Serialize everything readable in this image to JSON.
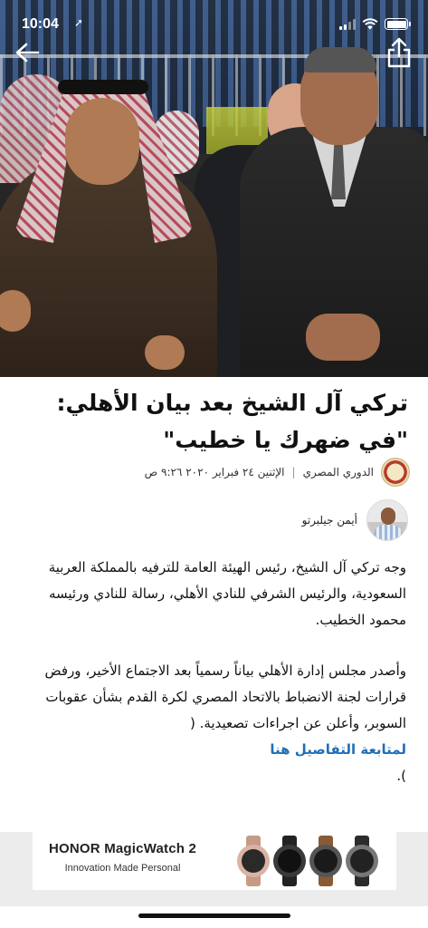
{
  "status_bar": {
    "time": "10:04",
    "location_glyph": "➚"
  },
  "nav": {
    "back_icon": "arrow-left-icon",
    "share_icon": "share-icon"
  },
  "article": {
    "headline": "تركي آل الشيخ بعد بيان الأهلي: \"في ضهرك يا خطيب\"",
    "league": "الدوري المصري",
    "date": "الإثنين ٢٤ فبراير ٢٠٢٠ ٩:٢٦ ص",
    "author": "أيمن جيلبرتو",
    "para1": "وجه تركي آل الشيخ، رئيس الهيئة العامة للترفيه بالمملكة العربية السعودية، والرئيس الشرفي للنادي الأهلي، رسالة للنادي ورئيسه محمود الخطيب.",
    "para2": "وأصدر مجلس إدارة الأهلي بياناً رسمياً بعد الاجتماع الأخير، ورفض قرارات لجنة الانضباط بالاتحاد المصري لكرة القدم بشأن عقوبات السوبر، وأعلن عن اجراءات تصعيدية. (",
    "link_text": "لمتابعة التفاصيل هنا",
    "closing": ")."
  },
  "ad": {
    "brand": "HONOR MagicWatch 2",
    "tagline": "Innovation Made Personal"
  },
  "colors": {
    "link": "#1f6fb6",
    "ad_background": "#ececec"
  }
}
